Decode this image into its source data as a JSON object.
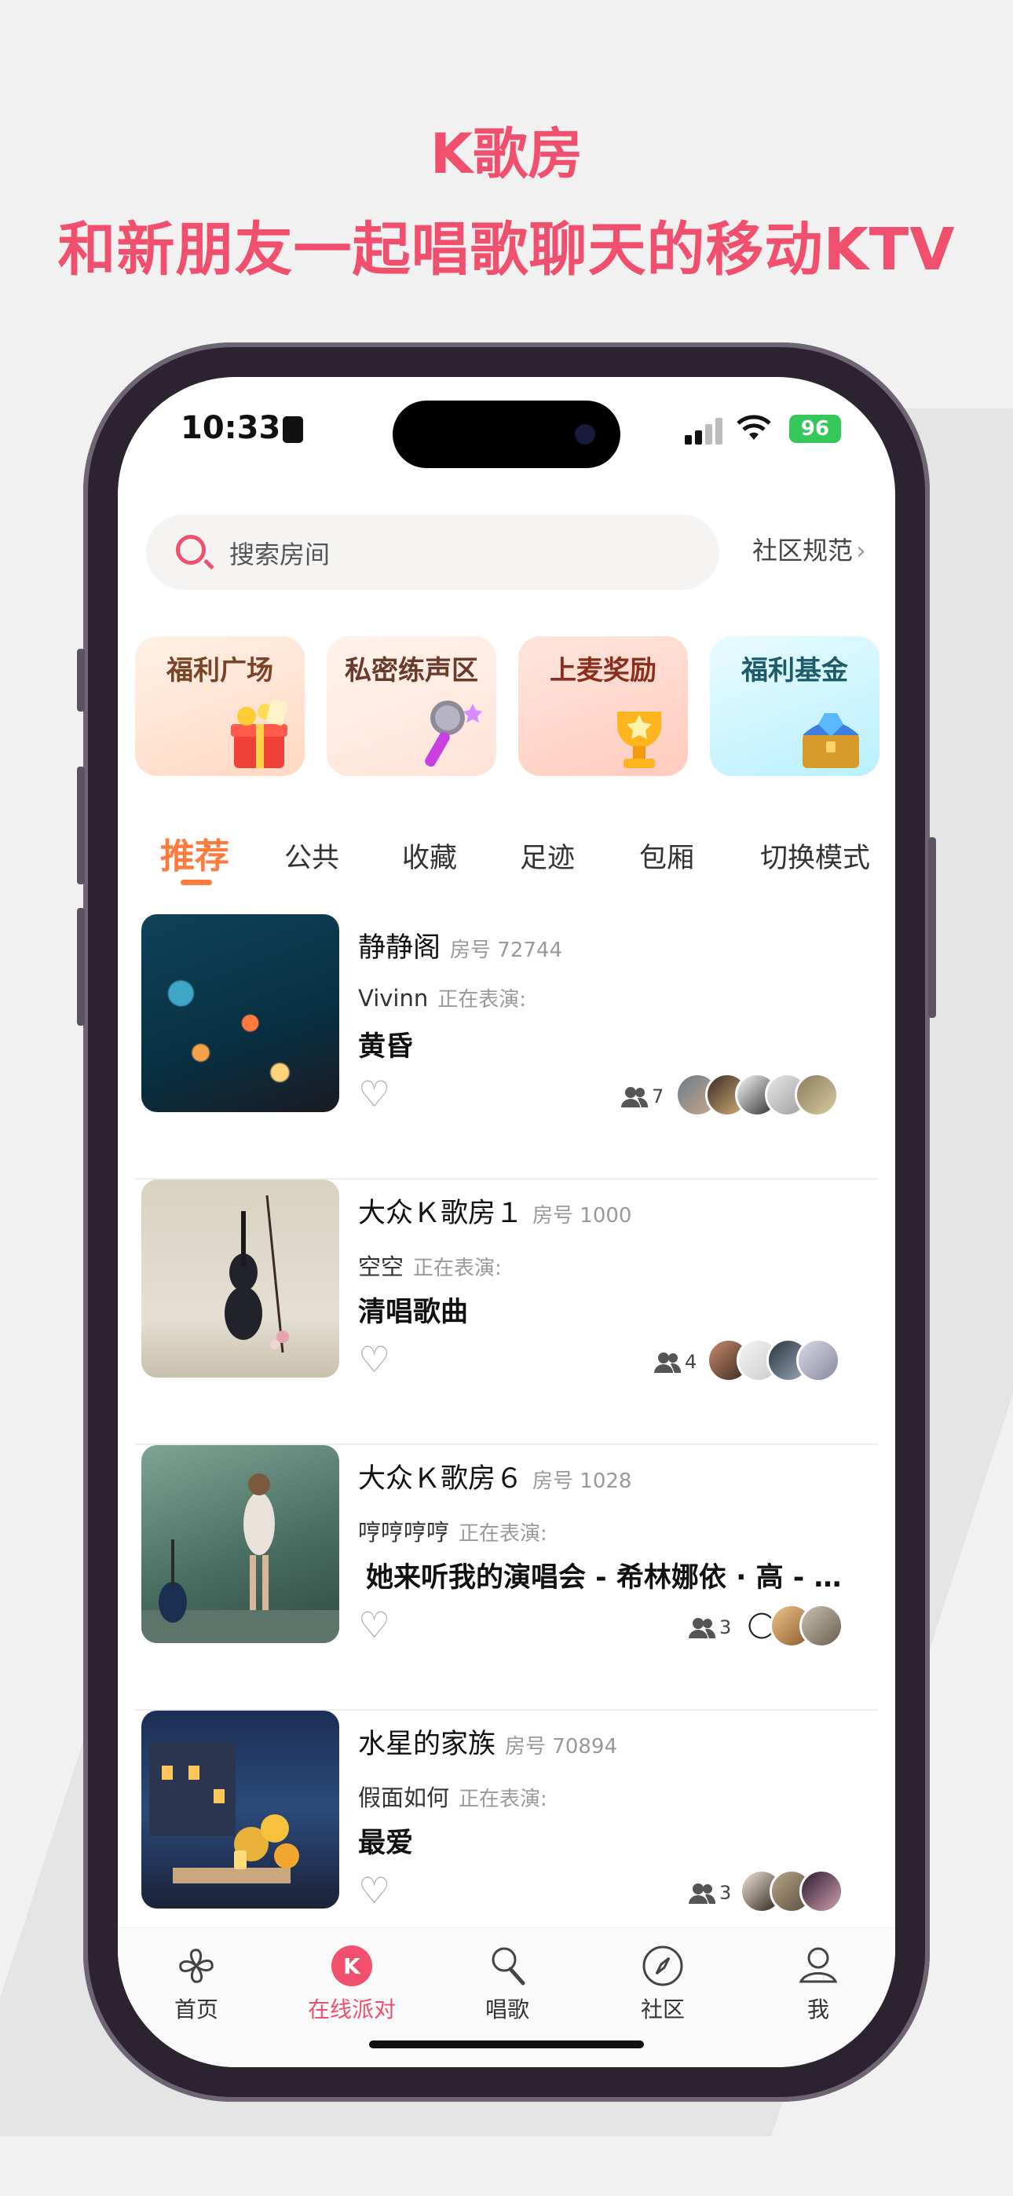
{
  "promo": {
    "title": "K歌房",
    "subtitle": "和新朋友一起唱歌聊天的移动KTV"
  },
  "status_bar": {
    "time": "10:33",
    "battery": "96"
  },
  "search": {
    "placeholder": "搜索房间",
    "rules_link": "社区规范"
  },
  "feature_cards": [
    {
      "label": "福利广场",
      "icon": "gift-box-icon",
      "color": "#7a4426"
    },
    {
      "label": "私密练声区",
      "icon": "microphone-icon",
      "color": "#6a3a2a"
    },
    {
      "label": "上麦奖励",
      "icon": "trophy-icon",
      "color": "#8a2f1d"
    },
    {
      "label": "福利基金",
      "icon": "treasure-chest-icon",
      "color": "#1d5a6a"
    }
  ],
  "tabs": [
    "推荐",
    "公共",
    "收藏",
    "足迹",
    "包厢",
    "切换模式"
  ],
  "rooms": [
    {
      "title": "静静阁",
      "room_no": "房号 72744",
      "singer": "Vivinn",
      "performing": "正在表演:",
      "song": "黄昏",
      "members": "7"
    },
    {
      "title": "大众Ｋ歌房１",
      "room_no": "房号 1000",
      "singer": "空空",
      "performing": "正在表演:",
      "song": "清唱歌曲",
      "members": "4"
    },
    {
      "title": "大众Ｋ歌房６",
      "room_no": "房号 1028",
      "singer": "哼哼哼哼",
      "performing": "正在表演:",
      "song": "她来听我的演唱会 - 希林娜依 · 高 - [伴奏]",
      "members": "3"
    },
    {
      "title": "水星的家族",
      "room_no": "房号 70894",
      "singer": "假面如何",
      "performing": "正在表演:",
      "song": "最爱",
      "members": "3"
    }
  ],
  "tabbar": [
    {
      "label": "首页",
      "icon": "pinwheel-icon"
    },
    {
      "label": "在线派对",
      "icon": "k-badge-icon"
    },
    {
      "label": "唱歌",
      "icon": "microphone-icon"
    },
    {
      "label": "社区",
      "icon": "compass-icon"
    },
    {
      "label": "我",
      "icon": "profile-icon"
    }
  ],
  "colors": {
    "brand_pink": "#f0506e",
    "active_tab_orange": "#ff7a3d"
  }
}
